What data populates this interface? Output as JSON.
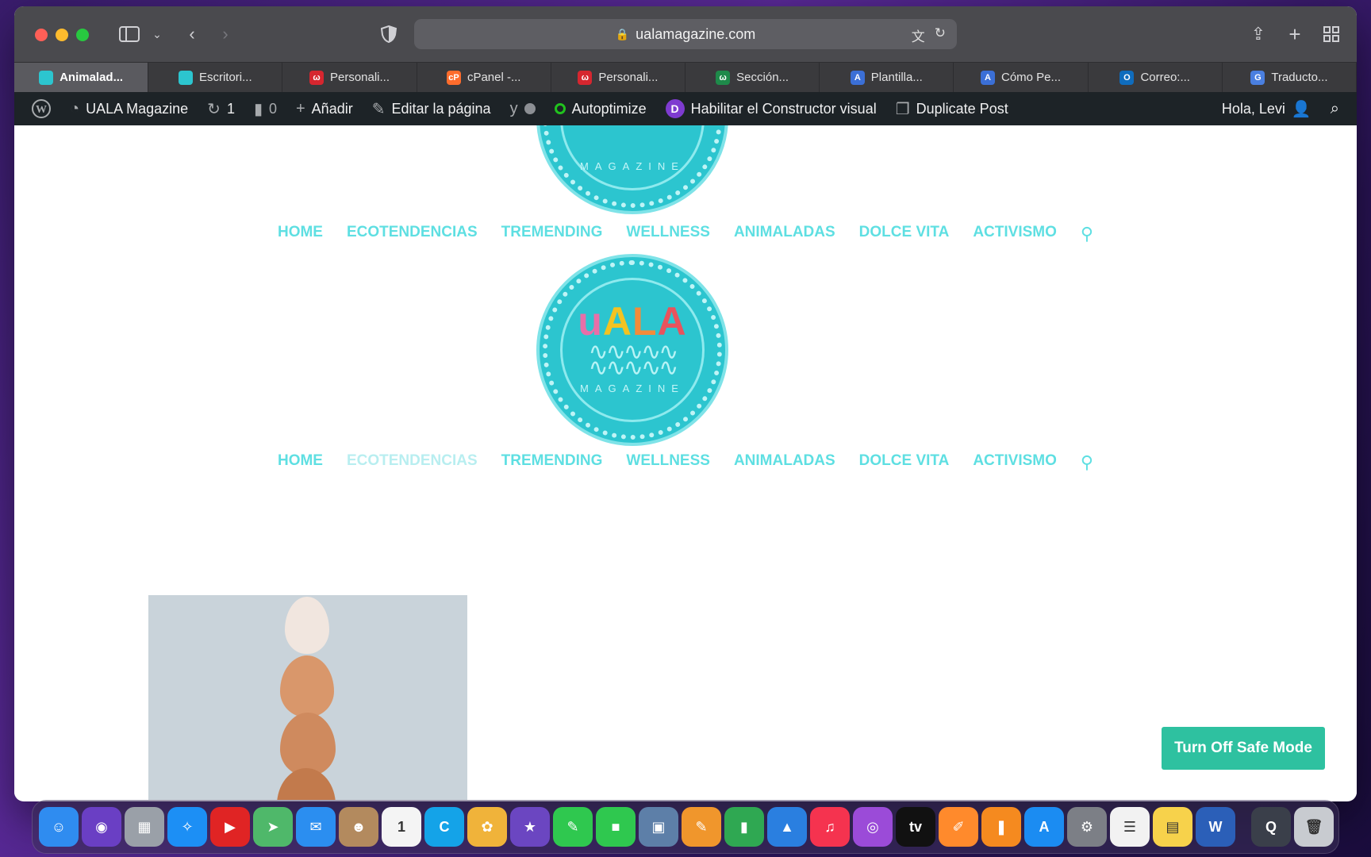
{
  "browser": {
    "url": "ualamagazine.com",
    "tabs": [
      {
        "label": "Animalad...",
        "active": true,
        "favicon_color": "#2cc5cf",
        "favicon_glyph": ""
      },
      {
        "label": "Escritori...",
        "active": false,
        "favicon_color": "#2cc5cf",
        "favicon_glyph": ""
      },
      {
        "label": "Personali...",
        "active": false,
        "favicon_color": "#d6262f",
        "favicon_glyph": "ω"
      },
      {
        "label": "cPanel -...",
        "active": false,
        "favicon_color": "#ff6c2c",
        "favicon_glyph": "cP"
      },
      {
        "label": "Personali...",
        "active": false,
        "favicon_color": "#d6262f",
        "favicon_glyph": "ω"
      },
      {
        "label": "Sección...",
        "active": false,
        "favicon_color": "#1e8a4a",
        "favicon_glyph": "ω"
      },
      {
        "label": "Plantilla...",
        "active": false,
        "favicon_color": "#3b6fd6",
        "favicon_glyph": "A"
      },
      {
        "label": "Cómo Pe...",
        "active": false,
        "favicon_color": "#3b6fd6",
        "favicon_glyph": "A"
      },
      {
        "label": "Correo:...",
        "active": false,
        "favicon_color": "#0f6cbd",
        "favicon_glyph": "O"
      },
      {
        "label": "Traducto...",
        "active": false,
        "favicon_color": "#4a7fe0",
        "favicon_glyph": "G"
      }
    ]
  },
  "adminbar": {
    "site_name": "UALA Magazine",
    "updates": "1",
    "comments": "0",
    "add_new": "Añadir",
    "edit_page": "Editar la página",
    "autoptimize": "Autoptimize",
    "visual_builder": "Habilitar el Constructor visual",
    "duplicate_post": "Duplicate Post",
    "greeting": "Hola, Levi"
  },
  "site": {
    "logo_text": "uALA",
    "logo_sub": "MAGAZINE",
    "nav": [
      "HOME",
      "ECOTENDENCIAS",
      "TREMENDING",
      "WELLNESS",
      "ANIMALADAS",
      "DOLCE VITA",
      "ACTIVISMO"
    ],
    "safe_mode_button": "Turn Off Safe Mode"
  },
  "colors": {
    "accent": "#5edfe2",
    "logo_bg": "#2cc5cf",
    "safe_mode": "#2ec1a0",
    "admin_bar": "#1d2327"
  },
  "dock": [
    {
      "name": "finder-icon",
      "color": "#2f8cf0",
      "glyph": "☺"
    },
    {
      "name": "siri-icon",
      "color": "#6a3fc4",
      "glyph": "◉"
    },
    {
      "name": "launchpad-icon",
      "color": "#9aa0a8",
      "glyph": "▦"
    },
    {
      "name": "safari-icon",
      "color": "#1c8ff5",
      "glyph": "✧"
    },
    {
      "name": "youtube-icon",
      "color": "#e02424",
      "glyph": "▶"
    },
    {
      "name": "maps-icon",
      "color": "#4fb86a",
      "glyph": "➤"
    },
    {
      "name": "mail-icon",
      "color": "#2b8ef0",
      "glyph": "✉"
    },
    {
      "name": "contacts-icon",
      "color": "#b38a5e",
      "glyph": "☻"
    },
    {
      "name": "calendar-icon",
      "color": "#f4f4f4",
      "glyph": "1"
    },
    {
      "name": "canva-icon",
      "color": "#14a3e8",
      "glyph": "C"
    },
    {
      "name": "photos-icon",
      "color": "#f0b33a",
      "glyph": "✿"
    },
    {
      "name": "imovie-icon",
      "color": "#6b46c1",
      "glyph": "★"
    },
    {
      "name": "messages-icon",
      "color": "#2fc84f",
      "glyph": "✎"
    },
    {
      "name": "facetime-icon",
      "color": "#2fc84f",
      "glyph": "■"
    },
    {
      "name": "preview-icon",
      "color": "#5d7fa8",
      "glyph": "▣"
    },
    {
      "name": "pages-icon",
      "color": "#f0962c",
      "glyph": "✎"
    },
    {
      "name": "numbers-icon",
      "color": "#2fa852",
      "glyph": "▮"
    },
    {
      "name": "keynote-icon",
      "color": "#2a7fe0",
      "glyph": "▲"
    },
    {
      "name": "music-icon",
      "color": "#f5334f",
      "glyph": "♫"
    },
    {
      "name": "podcasts-icon",
      "color": "#9b4bd8",
      "glyph": "◎"
    },
    {
      "name": "appletv-icon",
      "color": "#111111",
      "glyph": "tv"
    },
    {
      "name": "pages-doc-icon",
      "color": "#ff8a2c",
      "glyph": "✐"
    },
    {
      "name": "books-icon",
      "color": "#f58a1f",
      "glyph": "❚"
    },
    {
      "name": "appstore-icon",
      "color": "#1b8cf2",
      "glyph": "A"
    },
    {
      "name": "system-preferences-icon",
      "color": "#7c7f86",
      "glyph": "⚙"
    },
    {
      "name": "reminders-icon",
      "color": "#f2f2f2",
      "glyph": "☰"
    },
    {
      "name": "notes-icon",
      "color": "#f7d24b",
      "glyph": "▤"
    },
    {
      "name": "word-icon",
      "color": "#2b5fb8",
      "glyph": "W"
    },
    {
      "name": "quicktime-icon",
      "color": "#3a3f4a",
      "glyph": "Q"
    },
    {
      "name": "trash-icon",
      "color": "#c8cbd0",
      "glyph": "🗑"
    }
  ]
}
